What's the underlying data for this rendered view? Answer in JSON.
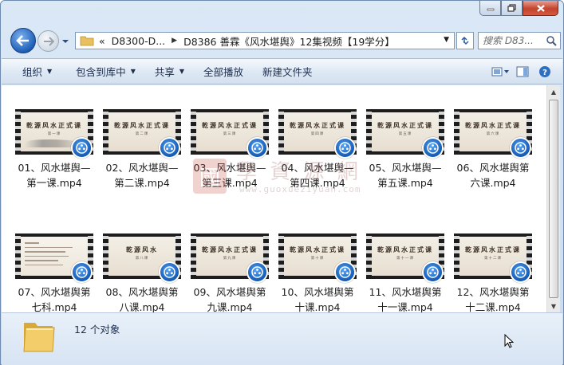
{
  "window": {
    "caption_buttons": [
      "minimize",
      "maximize",
      "close"
    ]
  },
  "address_bar": {
    "overflow": "«",
    "segments": [
      "D8300-D...",
      "D8386 善霖《风水堪舆》12集视频【19学分】"
    ]
  },
  "search": {
    "placeholder": "搜索 D83..."
  },
  "toolbar": {
    "organize": "组织",
    "include_in_library": "包含到库中",
    "share": "共享",
    "play_all": "全部播放",
    "new_folder": "新建文件夹"
  },
  "files": [
    {
      "line1": "01、风水堪舆—",
      "line2": "第一课.mp4",
      "thumb_title": "乾源风水正式课",
      "thumb_sub": "第一课",
      "style": "ink"
    },
    {
      "line1": "02、风水堪舆—",
      "line2": "第二课.mp4",
      "thumb_title": "乾源风水正式课",
      "thumb_sub": "第二课",
      "style": "plain"
    },
    {
      "line1": "03、风水堪舆—",
      "line2": "第三课.mp4",
      "thumb_title": "乾源风水正式课",
      "thumb_sub": "第三课",
      "style": "plain"
    },
    {
      "line1": "04、风水堪舆—",
      "line2": "第四课.mp4",
      "thumb_title": "乾源风水正式课",
      "thumb_sub": "第四课",
      "style": "plain"
    },
    {
      "line1": "05、风水堪舆—",
      "line2": "第五课.mp4",
      "thumb_title": "乾源风水正式课",
      "thumb_sub": "第五课",
      "style": "plain"
    },
    {
      "line1": "06、风水堪舆第",
      "line2": "六课.mp4",
      "thumb_title": "乾源风水正式课",
      "thumb_sub": "第六课",
      "style": "plain"
    },
    {
      "line1": "07、风水堪舆第",
      "line2": "七科.mp4",
      "thumb_title": "",
      "thumb_sub": "",
      "style": "text"
    },
    {
      "line1": "08、风水堪舆第",
      "line2": "八课.mp4",
      "thumb_title": "乾源风水",
      "thumb_sub": "第八课",
      "style": "plain"
    },
    {
      "line1": "09、风水堪舆第",
      "line2": "九课.mp4",
      "thumb_title": "乾源风水正式课",
      "thumb_sub": "第九课",
      "style": "plain"
    },
    {
      "line1": "10、风水堪舆第",
      "line2": "十课.mp4",
      "thumb_title": "乾源风水正式课",
      "thumb_sub": "第十课",
      "style": "plain"
    },
    {
      "line1": "11、风水堪舆第",
      "line2": "十一课.mp4",
      "thumb_title": "乾源风水正式课",
      "thumb_sub": "第十一课",
      "style": "plain"
    },
    {
      "line1": "12、风水堪舆第",
      "line2": "十二课.mp4",
      "thumb_title": "乾源风水正式课",
      "thumb_sub": "第十二课",
      "style": "plain"
    }
  ],
  "watermark": {
    "logo_char": "國",
    "chinese": "學 資 源 網",
    "url": "www.guoxueziyuan.com"
  },
  "status": {
    "item_count": "12 个对象"
  },
  "colors": {
    "accent": "#1d5eb8",
    "toolbar_text": "#1e2f4f",
    "close_red": "#c4432d"
  }
}
